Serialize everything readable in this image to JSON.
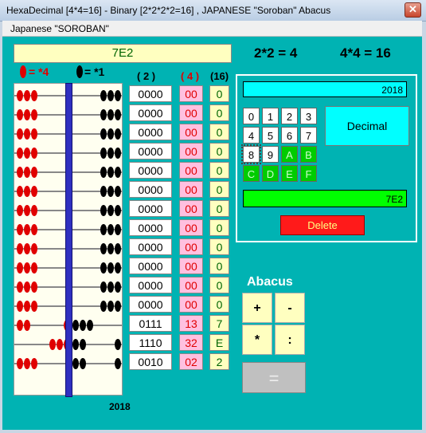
{
  "window": {
    "title": "HexaDecimal [4*4=16]  -  Binary [2*2*2*2=16] ,  JAPANESE  \"Soroban\" Abacus",
    "close": "✕"
  },
  "menu": {
    "label": "Japanese  \"SOROBAN\""
  },
  "display": "7E2",
  "formula1": "2*2 = 4",
  "formula2": "4*4 = 16",
  "legend": {
    "red": "=  *4",
    "black": "=  *1"
  },
  "headers": {
    "base2": "( 2 )",
    "base4": "( 4 )",
    "base16": "(16)"
  },
  "rows": [
    {
      "b2": "0000",
      "b4": "00",
      "b16": "0"
    },
    {
      "b2": "0000",
      "b4": "00",
      "b16": "0"
    },
    {
      "b2": "0000",
      "b4": "00",
      "b16": "0"
    },
    {
      "b2": "0000",
      "b4": "00",
      "b16": "0"
    },
    {
      "b2": "0000",
      "b4": "00",
      "b16": "0"
    },
    {
      "b2": "0000",
      "b4": "00",
      "b16": "0"
    },
    {
      "b2": "0000",
      "b4": "00",
      "b16": "0"
    },
    {
      "b2": "0000",
      "b4": "00",
      "b16": "0"
    },
    {
      "b2": "0000",
      "b4": "00",
      "b16": "0"
    },
    {
      "b2": "0000",
      "b4": "00",
      "b16": "0"
    },
    {
      "b2": "0000",
      "b4": "00",
      "b16": "0"
    },
    {
      "b2": "0000",
      "b4": "00",
      "b16": "0"
    },
    {
      "b2": "0111",
      "b4": "13",
      "b16": "7"
    },
    {
      "b2": "1110",
      "b4": "32",
      "b16": "E"
    },
    {
      "b2": "0010",
      "b4": "02",
      "b16": "2"
    }
  ],
  "year_bottom": "2018",
  "year_box": "2018",
  "keys": [
    "0",
    "1",
    "2",
    "3",
    "4",
    "5",
    "6",
    "7",
    "8",
    "9",
    "A",
    "B",
    "C",
    "D",
    "E",
    "F"
  ],
  "decimal_label": "Decimal",
  "hex_value": "7E2",
  "delete_label": "Delete",
  "abacus_label": "Abacus",
  "ops": {
    "plus": "+",
    "minus": "-",
    "times": "*",
    "divide": ":",
    "equals": "="
  }
}
